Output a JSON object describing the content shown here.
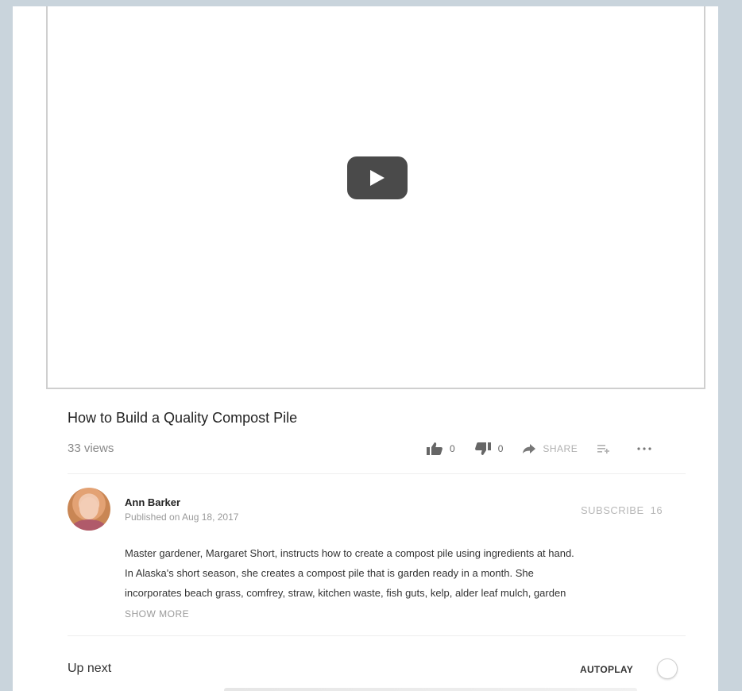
{
  "video": {
    "title": "How to Build a Quality Compost Pile",
    "views": "33 views",
    "likes": "0",
    "dislikes": "0",
    "share_label": "SHARE"
  },
  "channel": {
    "author": "Ann Barker",
    "published": "Published on Aug 18, 2017",
    "subscribe_label": "SUBSCRIBE",
    "subscriber_count": "16"
  },
  "description": {
    "line1": "Master gardener, Margaret Short, instructs how to create a compost pile using ingredients at hand.",
    "line2": "In Alaska's short season, she creates a compost pile that is garden ready in a month. She",
    "line3": "incorporates beach grass, comfrey, straw, kitchen waste, fish guts, kelp, alder leaf mulch, garden",
    "show_more": "SHOW MORE"
  },
  "up_next": {
    "label": "Up next",
    "autoplay_label": "AUTOPLAY",
    "autoplay_on": false
  },
  "icons": {
    "play": "play-icon",
    "like": "thumbs-up-icon",
    "dislike": "thumbs-down-icon",
    "share": "share-arrow-icon",
    "add": "add-to-playlist-icon",
    "more": "more-horizontal-icon"
  },
  "colors": {
    "page_background": "#c9d4dc",
    "play_button": "#4a4a4a"
  }
}
